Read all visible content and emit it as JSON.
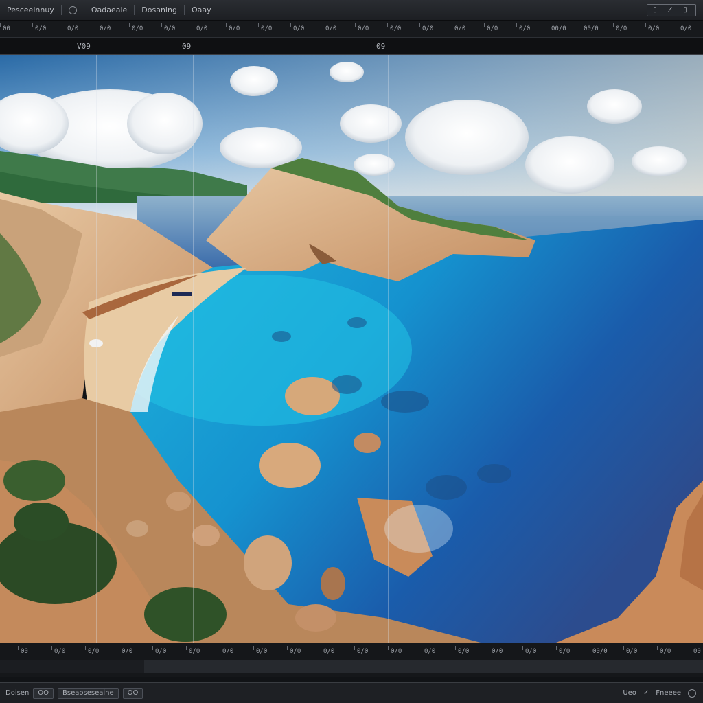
{
  "menubar": {
    "items": [
      {
        "label": "Pesceeinnuy"
      },
      {
        "label": "Oadaeaie"
      },
      {
        "label": "Dosaning"
      },
      {
        "label": "Oaay"
      }
    ],
    "tools": {
      "pen": "⁄",
      "a": "▯",
      "b": "▯"
    }
  },
  "ruler": {
    "top_labels": [
      "00",
      "0/0",
      "0/0",
      "0/0",
      "0/0",
      "0/0",
      "0/0",
      "0/0",
      "0/0",
      "0/0",
      "0/0",
      "0/0",
      "0/0",
      "0/0",
      "0/0",
      "0/0",
      "0/0",
      "00/0",
      "00/0",
      "0/0",
      "0/0",
      "0/0"
    ],
    "bottom_labels": [
      "V09",
      "09",
      "09"
    ]
  },
  "timeline": {
    "labels": [
      "00",
      "0/0",
      "0/0",
      "0/0",
      "0/0",
      "0/0",
      "0/0",
      "0/0",
      "0/0",
      "0/0",
      "0/0",
      "0/0",
      "0/0",
      "0/0",
      "0/0",
      "0/0",
      "0/0",
      "00/0",
      "0/0",
      "0/0",
      "00"
    ]
  },
  "statusbar": {
    "left_label": "Doisen",
    "btn1": "OO",
    "btn2": "Bseaoseseaine",
    "btn3": "OO",
    "right1": "Ueo",
    "right2": "Fneeee"
  },
  "colors": {
    "sky_top": "#2f6fa8",
    "sea_turquoise": "#1fb0d8",
    "sea_deep": "#1a4d9a",
    "cliff": "#d9b28a"
  }
}
